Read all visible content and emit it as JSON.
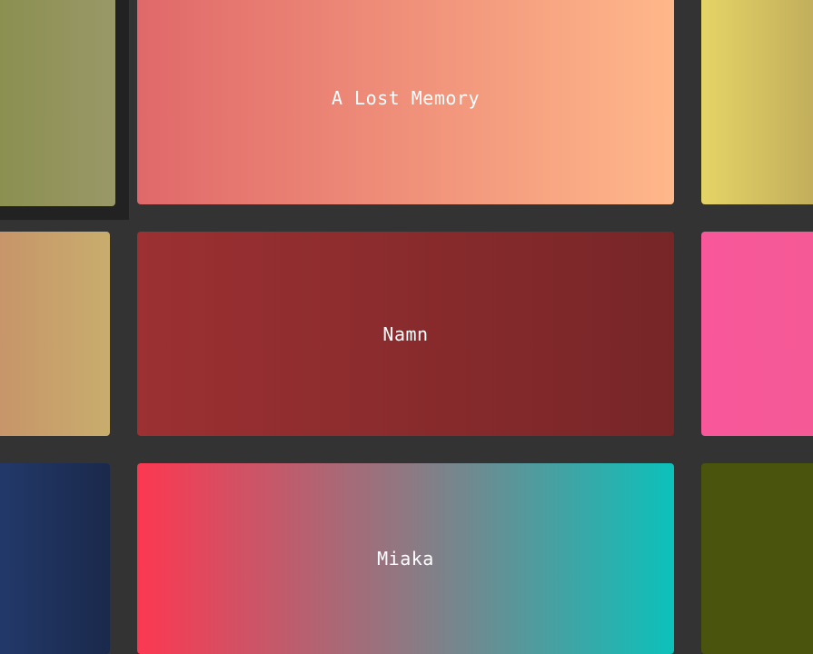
{
  "cards": {
    "center": [
      {
        "label": "A Lost Memory",
        "colors": [
          "#e0686a",
          "#ffb88a"
        ]
      },
      {
        "label": "Namn",
        "colors": [
          "#9c3032",
          "#772628"
        ]
      },
      {
        "label": "Miaka",
        "colors": [
          "#fc3851",
          "#0cc1bb"
        ]
      }
    ],
    "left": [
      {
        "colors": [
          "#8a8f4e",
          "#999868"
        ]
      },
      {
        "colors": [
          "#c79369",
          "#c8ad6d"
        ]
      },
      {
        "colors": [
          "#233a6c",
          "#1a294b"
        ]
      }
    ],
    "right": [
      {
        "colors": [
          "#e5d466",
          "#bda95b"
        ]
      },
      {
        "colors": [
          "#f8589a",
          "#f55a95"
        ]
      },
      {
        "colors": [
          "#4a540d",
          "#4a540d"
        ]
      }
    ]
  },
  "background": "#333333"
}
